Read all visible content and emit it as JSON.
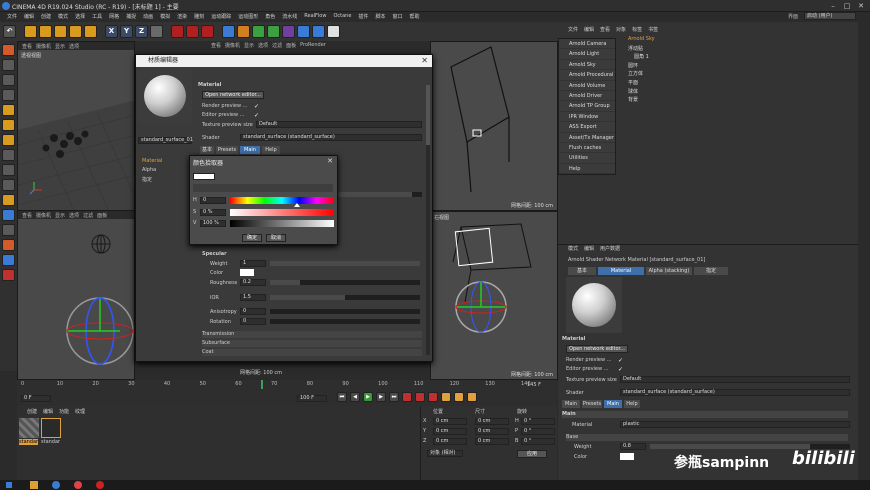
{
  "app": {
    "title": "CINEMA 4D R19.024 Studio (RC - R19) - [未标题 1] - 主要"
  },
  "menubar": {
    "items": [
      "文件",
      "编辑",
      "创建",
      "模式",
      "选择",
      "工具",
      "网格",
      "捕捉",
      "动画",
      "模拟",
      "渲染",
      "雕刻",
      "运动跟踪",
      "运动图形",
      "角色",
      "流水线",
      "RealFlow",
      "Octane",
      "插件",
      "脚本",
      "窗口",
      "帮助"
    ],
    "layout_label": "界面",
    "layout_value": "启动 (用户)"
  },
  "toolbar": {
    "undo": "↶",
    "x": "X",
    "y": "Y",
    "z": "Z"
  },
  "viewport_menu": [
    "查看",
    "摄像机",
    "显示",
    "选项",
    "过滤",
    "面板",
    "ProRender"
  ],
  "viewports": {
    "persp": "透视视图",
    "right": "右视图",
    "grid_dist": "网格间距: 100 cm"
  },
  "material_editor": {
    "title": "材质编辑器",
    "name": "standard_surface_01",
    "section": "Material",
    "open_btn": "Open network editor...",
    "render_preview": "Render preview ...",
    "editor_preview": "Editor preview ...",
    "texture_size_label": "Texture preview size",
    "texture_size": "Default",
    "shader_label": "Shader",
    "shader_value": "standard_surface (standard_surface)",
    "tabs": [
      "基本",
      "Presets",
      "Main",
      "Help"
    ],
    "left_list": [
      "Material",
      "Alpha",
      "指定"
    ],
    "specular": "Specular",
    "props": [
      {
        "label": "Weight",
        "value": "1"
      },
      {
        "label": "Color",
        "value": ""
      },
      {
        "label": "Roughness",
        "value": "0.2"
      },
      {
        "label": "IOR",
        "value": "1.5"
      },
      {
        "label": "Anisotropy",
        "value": "0"
      },
      {
        "label": "Rotation",
        "value": "0"
      }
    ],
    "sections": [
      "Transmission",
      "Subsurface",
      "Coat"
    ]
  },
  "color_picker": {
    "title": "颜色拾取器",
    "h_label": "H",
    "h_value": "0",
    "s_label": "S",
    "s_value": "0 %",
    "v_label": "V",
    "v_value": "100 %",
    "ok": "确定",
    "cancel": "取消"
  },
  "object_manager": {
    "menu": [
      "文件",
      "编辑",
      "查看",
      "对象",
      "标签",
      "书签"
    ],
    "arnold_items": [
      "Arnold Camera",
      "Arnold Light",
      "Arnold Sky",
      "Arnold Procedural",
      "Arnold Volume",
      "Arnold Driver",
      "Arnold TP Group",
      "IPR Window",
      "ASS Export",
      "Asset/Tx Manager",
      "Flush caches",
      "Utilities",
      "Help"
    ],
    "objects": [
      "Arnold Sky",
      "浮动贴",
      "圆角 1",
      "圆环",
      "立方体",
      "平面",
      "球体",
      "背景"
    ]
  },
  "attributes": {
    "menu": [
      "模式",
      "编辑",
      "用户数据"
    ],
    "title": "Arnold Shader Network Material [standard_surface_01]",
    "tabs": [
      "基本",
      "Material",
      "Alpha (stacking)",
      "指定"
    ],
    "section": "Material",
    "open_btn": "Open network editor...",
    "render_preview": "Render preview ...",
    "editor_preview": "Editor preview ...",
    "texture_size_label": "Texture preview size",
    "texture_size": "Default",
    "shader_label": "Shader",
    "shader_value": "standard_surface (standard_surface)",
    "sub_tabs": [
      "Main",
      "Presets",
      "Main",
      "Help"
    ],
    "main_label": "Main",
    "material_label": "Material",
    "material_value": "plastic",
    "base_label": "Base",
    "weight_label": "Weight",
    "weight_value": "0.8",
    "color_label": "Color"
  },
  "timeline": {
    "ticks": [
      "0",
      "10",
      "20",
      "30",
      "40",
      "50",
      "60",
      "70",
      "80",
      "90",
      "100",
      "110",
      "120",
      "130",
      "140"
    ],
    "frame_start": "0 F",
    "frame_end": "100 F",
    "current": "145 F"
  },
  "material_manager": {
    "menu": [
      "创建",
      "编辑",
      "功能",
      "纹理"
    ],
    "materials": [
      "standar",
      "standar"
    ]
  },
  "coords": {
    "headers": [
      "位置",
      "尺寸",
      "旋转"
    ],
    "rows": [
      [
        "X",
        "0 cm",
        "0 cm",
        "H",
        "0 °"
      ],
      [
        "Y",
        "0 cm",
        "0 cm",
        "P",
        "0 °"
      ],
      [
        "Z",
        "0 cm",
        "0 cm",
        "B",
        "0 °"
      ]
    ],
    "mode": "对象 (相对)",
    "apply": "应用"
  },
  "watermark": {
    "text": "参瓶sampinn",
    "brand": "bilibili"
  },
  "colors": {
    "accent": "#3e6fa8",
    "hue_marker": "#ffffff"
  }
}
